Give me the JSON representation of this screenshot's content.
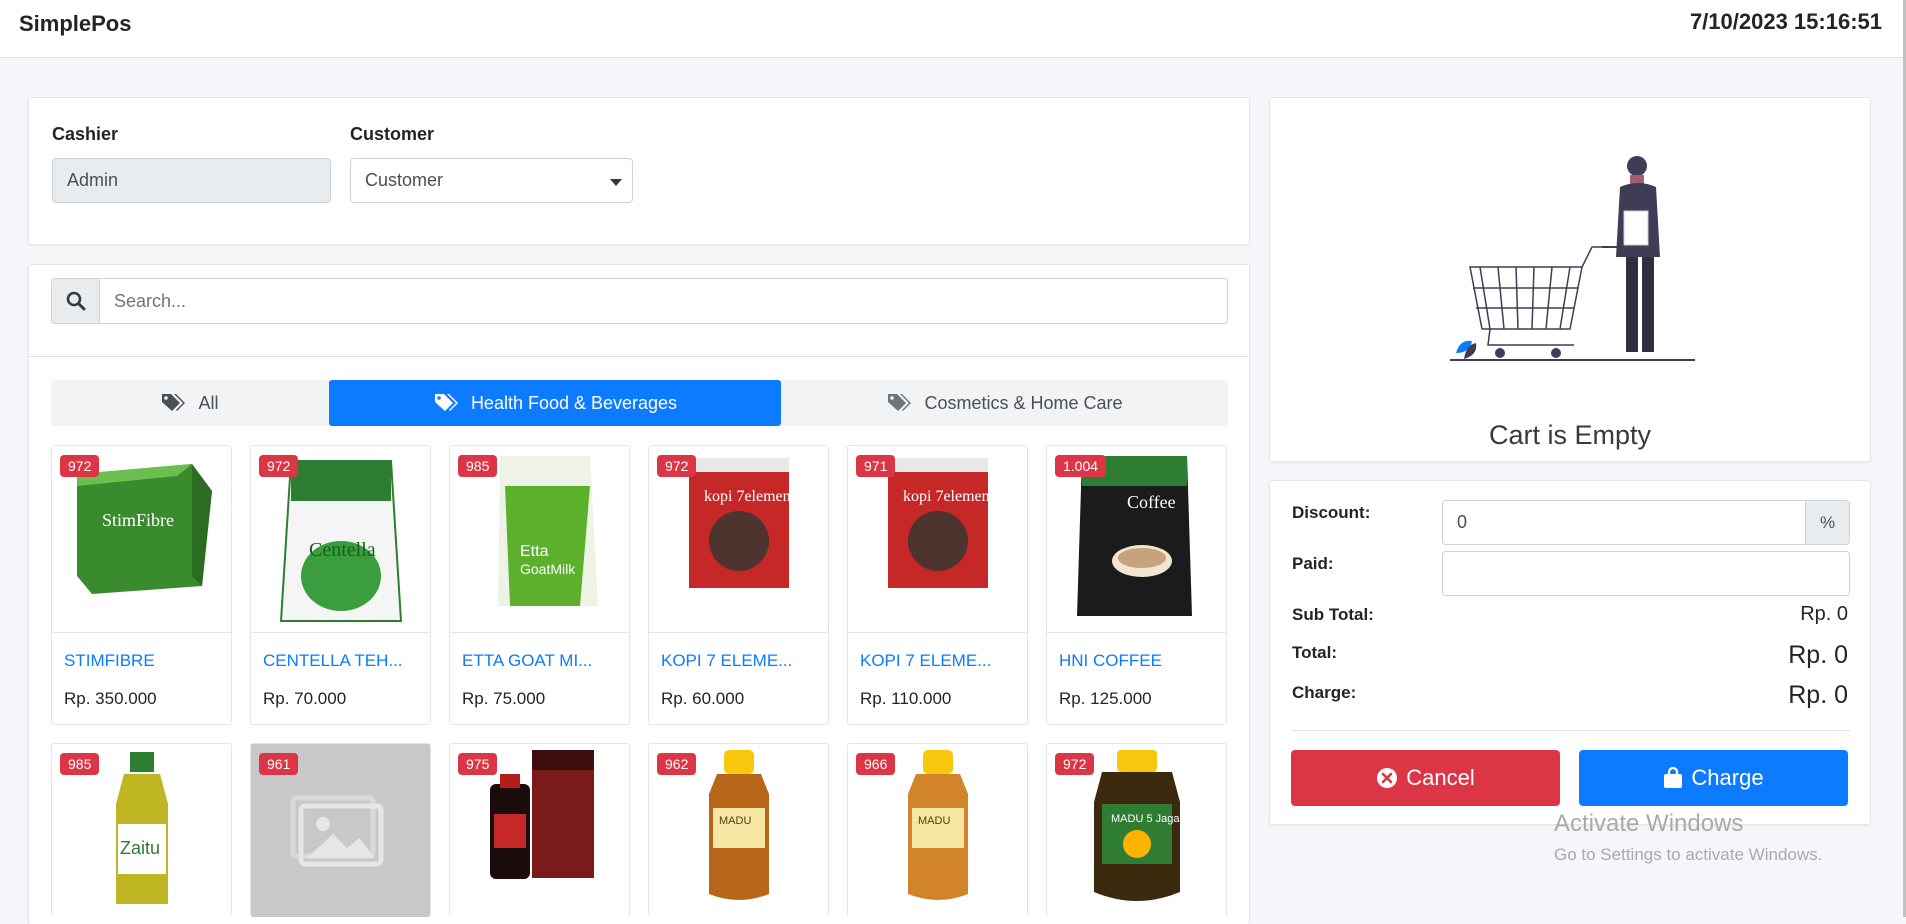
{
  "app": {
    "title": "SimplePos",
    "datetime": "7/10/2023 15:16:51"
  },
  "form": {
    "cashier_label": "Cashier",
    "cashier_value": "Admin",
    "customer_label": "Customer",
    "customer_selected": "Customer"
  },
  "search": {
    "placeholder": "Search..."
  },
  "tabs": [
    {
      "label": "All",
      "active": false
    },
    {
      "label": "Health Food & Beverages",
      "active": true
    },
    {
      "label": "Cosmetics & Home Care",
      "active": false
    }
  ],
  "products": [
    {
      "stock": "972",
      "name": "STIMFIBRE",
      "price": "Rp. 350.000"
    },
    {
      "stock": "972",
      "name": "CENTELLA TEH...",
      "price": "Rp. 70.000"
    },
    {
      "stock": "985",
      "name": "ETTA GOAT MI...",
      "price": "Rp. 75.000"
    },
    {
      "stock": "972",
      "name": "KOPI 7 ELEME...",
      "price": "Rp. 60.000"
    },
    {
      "stock": "971",
      "name": "KOPI 7 ELEME...",
      "price": "Rp. 110.000"
    },
    {
      "stock": "1.004",
      "name": "HNI COFFEE",
      "price": "Rp. 125.000"
    },
    {
      "stock": "985"
    },
    {
      "stock": "961"
    },
    {
      "stock": "975"
    },
    {
      "stock": "962"
    },
    {
      "stock": "966"
    },
    {
      "stock": "972"
    }
  ],
  "cart": {
    "empty_text": "Cart is Empty",
    "discount_label": "Discount:",
    "discount_value": "0",
    "discount_unit": "%",
    "paid_label": "Paid:",
    "paid_value": "",
    "subtotal_label": "Sub Total:",
    "subtotal_value": "Rp. 0",
    "total_label": "Total:",
    "total_value": "Rp. 0",
    "charge_label": "Charge:",
    "charge_value": "Rp. 0",
    "cancel_button": "Cancel",
    "charge_button": "Charge"
  },
  "watermark": {
    "line1": "Activate Windows",
    "line2": "Go to Settings to activate Windows."
  },
  "colors": {
    "primary": "#0d7bff",
    "danger": "#dc3545",
    "badge": "#dc3545"
  }
}
